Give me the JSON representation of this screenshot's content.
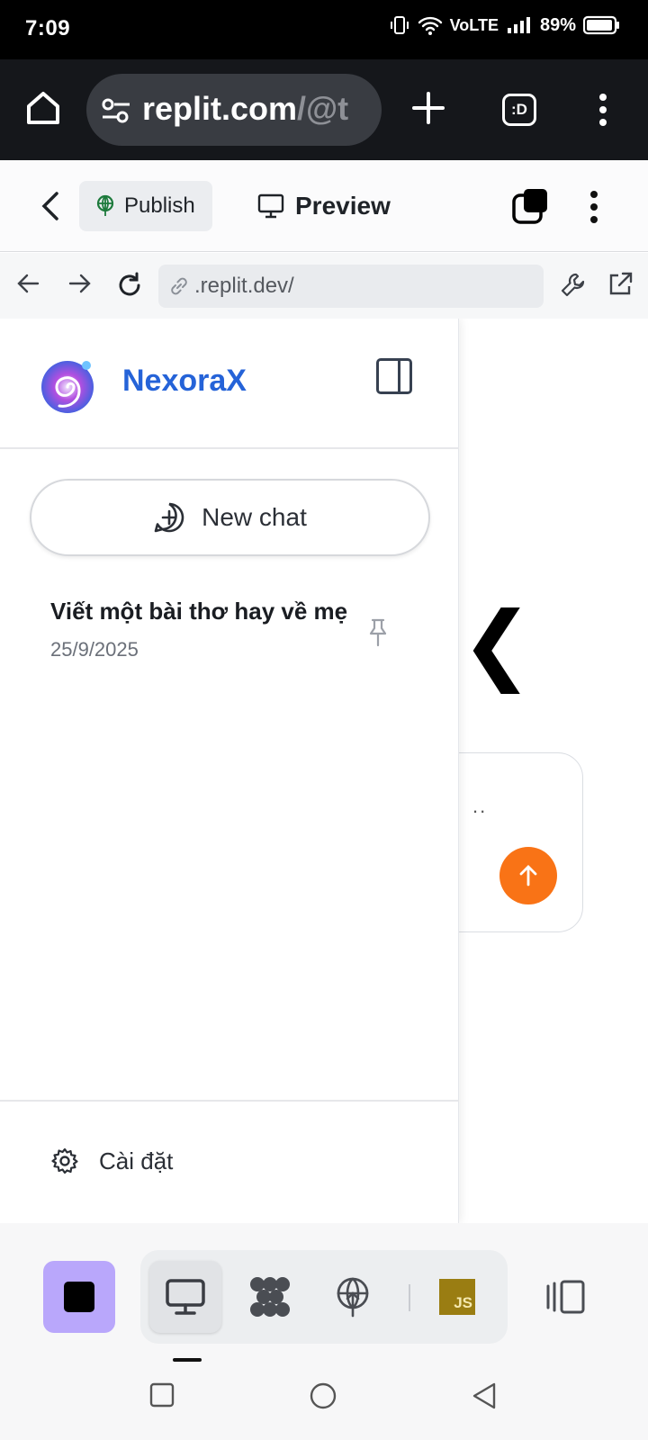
{
  "status_bar": {
    "time": "7:09",
    "network": "VoLTE",
    "battery": "89%"
  },
  "browser": {
    "url_main": "replit.com",
    "url_dim": "/@t",
    "tab_switcher_label": ":D"
  },
  "replit_toolbar": {
    "publish_label": "Publish",
    "preview_label": "Preview"
  },
  "webview": {
    "url": ".replit.dev/"
  },
  "sidebar": {
    "brand": "NexoraX",
    "new_chat_label": "New chat",
    "chats": [
      {
        "title": "Viết một bài thơ hay về mẹ",
        "date": "25/9/2025"
      }
    ],
    "settings_label": "Cài đặt"
  },
  "main": {
    "chevron_glyph": "❮",
    "input_placeholder_fragment": ".."
  },
  "dock": {
    "js_badge": "JS"
  },
  "colors": {
    "brand": "#2563d8",
    "send_button": "#f97316",
    "stop_button": "#b9a7fb",
    "js_badge": "#9a7d12"
  },
  "icons": [
    "home-icon",
    "tune-icon",
    "plus-icon",
    "tab-switcher-icon",
    "more-vert-icon",
    "back-icon",
    "publish-icon",
    "monitor-icon",
    "panes-icon",
    "arrow-left-icon",
    "arrow-right-icon",
    "reload-icon",
    "link-icon",
    "wrench-icon",
    "external-link-icon",
    "logo-icon",
    "sidebar-toggle-icon",
    "chat-plus-icon",
    "pin-icon",
    "gear-icon",
    "arrow-up-icon",
    "stop-icon",
    "monitor-icon",
    "workflow-icon",
    "deploy-icon",
    "js-icon",
    "panel-switch-icon",
    "square-nav-icon",
    "circle-nav-icon",
    "triangle-nav-icon"
  ]
}
